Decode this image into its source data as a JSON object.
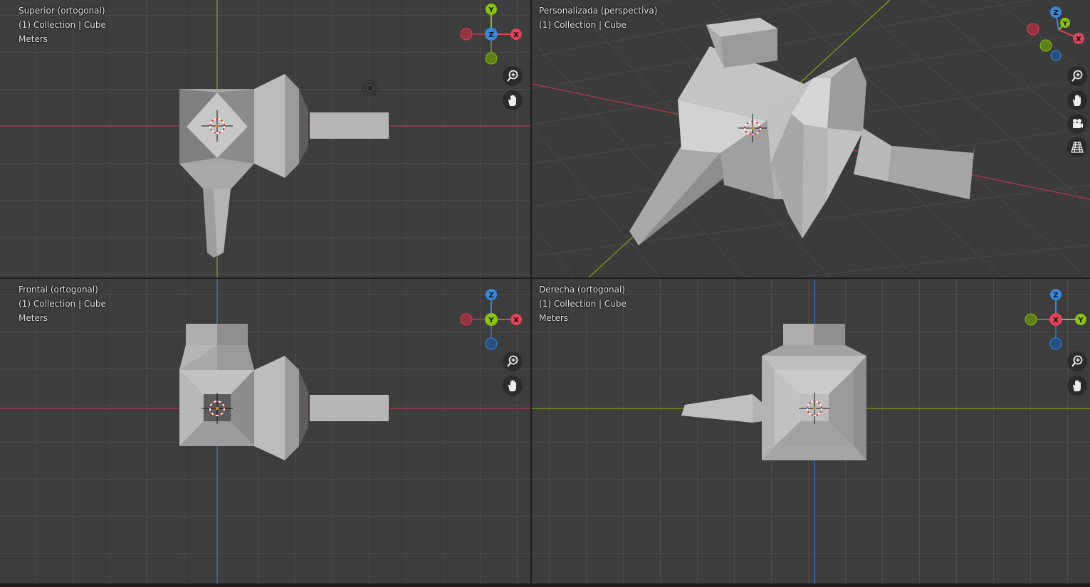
{
  "viewports": {
    "top": {
      "title": "Superior (ortogonal)",
      "collection": "(1) Collection | Cube",
      "units": "Meters"
    },
    "persp": {
      "title": "Personalizada (perspectiva)",
      "collection": "(1) Collection | Cube"
    },
    "front": {
      "title": "Frontal (ortogonal)",
      "collection": "(1) Collection | Cube",
      "units": "Meters"
    },
    "right": {
      "title": "Derecha (ortogonal)",
      "collection": "(1) Collection | Cube",
      "units": "Meters"
    }
  },
  "gizmo_labels": {
    "x": "X",
    "y": "Y",
    "z": "Z"
  },
  "nav_icons": [
    "zoom-icon",
    "hand-pan-icon",
    "camera-icon",
    "grid-perspective-icon"
  ],
  "colors": {
    "x_axis": "#e2425a",
    "y_axis": "#8ac40f",
    "z_axis": "#3589dd",
    "viewport_bg": "#3d3d3d",
    "mesh_light": "#c9c9c9",
    "mesh_mid": "#a9a9a9",
    "mesh_dark": "#7d7d7d",
    "selection_accent": "#4772b3"
  }
}
